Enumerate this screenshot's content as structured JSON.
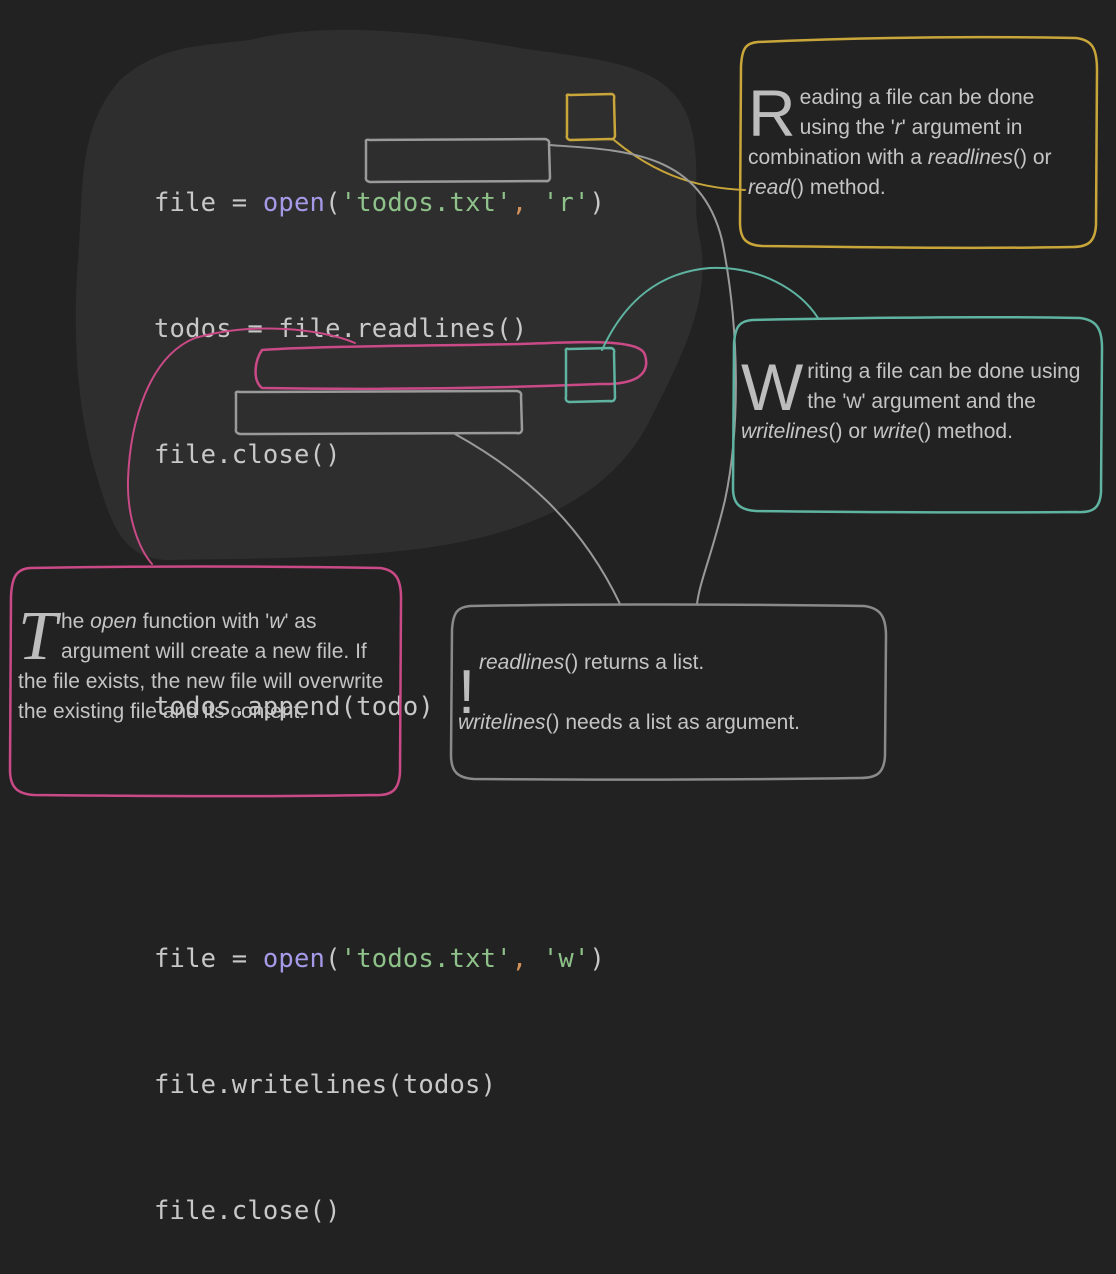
{
  "code": {
    "line1": {
      "a": "file = ",
      "fn": "open",
      "b": "(",
      "s": "'todos.txt'",
      "c": ", ",
      "arg": "'r'",
      "d": ")"
    },
    "line2": {
      "a": "todos = file.",
      "m": "readlines()"
    },
    "line3": "file.close()",
    "line5": "todos.append(todo)",
    "line7": {
      "a": "file = ",
      "fn": "open",
      "b": "(",
      "s": "'todos.txt'",
      "c": ", ",
      "arg": "'w'",
      "d": ")"
    },
    "line8": {
      "a": "file.",
      "m": "writelines(todos)"
    },
    "line9": "file.close()"
  },
  "notes": {
    "read": {
      "drop": "R",
      "t1": "eading a file can be done using the '",
      "arg": "r",
      "t2": "' argument in combination with a ",
      "m1": "readlines",
      "t3": "() or ",
      "m2": "read",
      "t4": "() method."
    },
    "write": {
      "drop": "W",
      "t1": "riting a file can be done using the 'w' argument and the ",
      "m1": "writelines",
      "t2": "() or ",
      "m2": "write",
      "t3": "() method."
    },
    "open": {
      "drop": "T",
      "t1": "he ",
      "m1": "open",
      "t2": " function with '",
      "arg": "w",
      "t3": "' as argument will create a new file. If the file exists, the new file will overwrite the existing file and its content."
    },
    "tip": {
      "bang": "!",
      "m1": "readlines",
      "t1": "() returns a list.",
      "m2": "writelines",
      "t2": "() needs a list as argument."
    }
  },
  "colors": {
    "background": "#222222",
    "code_area": "#2e2e2e",
    "yellow": "#c9a63a",
    "teal": "#5fb3a1",
    "magenta": "#c94a86",
    "gray": "#9a9a9a",
    "function": "#a59ae8",
    "string": "#8ec28a"
  }
}
